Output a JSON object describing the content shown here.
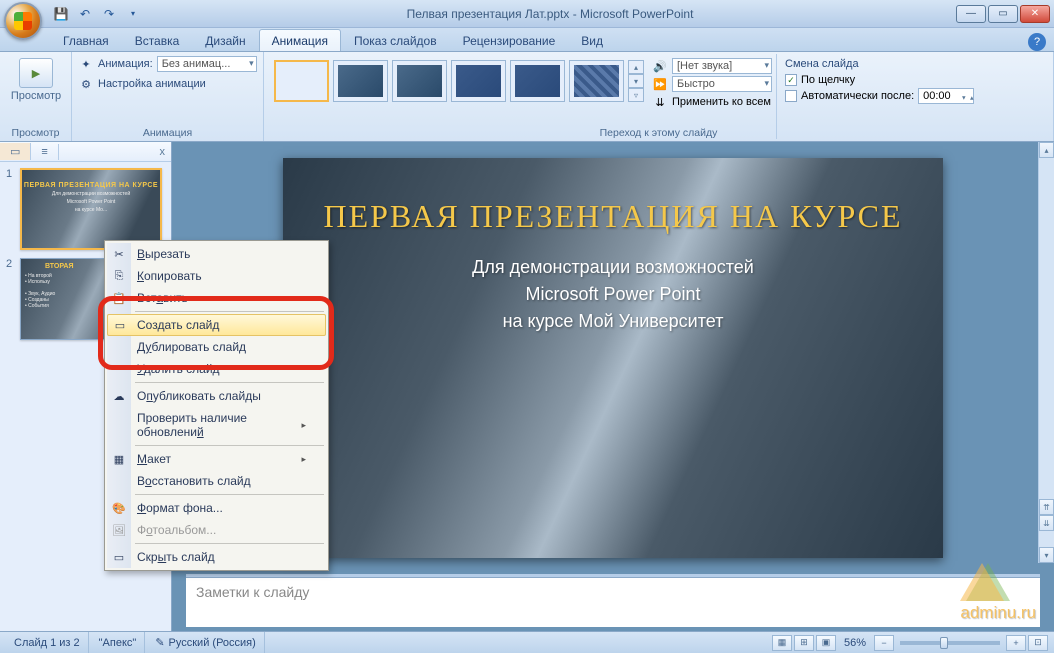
{
  "title": "Пелвая презентация Лат.pptx - Microsoft PowerPoint",
  "tabs": {
    "home": "Главная",
    "insert": "Вставка",
    "design": "Дизайн",
    "animation": "Анимация",
    "slideshow": "Показ слайдов",
    "review": "Рецензирование",
    "view": "Вид"
  },
  "ribbon": {
    "preview": {
      "label": "Просмотр",
      "group": "Просмотр"
    },
    "animation_group": {
      "label": "Анимация",
      "animate_label": "Анимация:",
      "animate_value": "Без анимац...",
      "custom_anim": "Настройка анимации"
    },
    "transition_group": {
      "label": "Переход к этому слайду",
      "sound_label": "[Нет звука]",
      "speed_label": "Быстро",
      "apply_all": "Применить ко всем"
    },
    "advance_group": {
      "title": "Смена слайда",
      "on_click": "По щелчку",
      "auto_after": "Автоматически после:",
      "time": "00:00"
    }
  },
  "leftpanel": {
    "tab_slides_icon": "▭",
    "tab_outline_icon": "≡",
    "close": "x"
  },
  "thumbs": [
    {
      "num": "1",
      "title": "ПЕРВАЯ ПРЕЗЕНТАЦИЯ НА КУРСЕ",
      "sub1": "Для демонстрации возможностей",
      "sub2": "Microsoft Power Point",
      "sub3": "на курсе Мо..."
    },
    {
      "num": "2",
      "title": "ВТОРАЯ",
      "sub": "..."
    }
  ],
  "slide": {
    "title": "ПЕРВАЯ ПРЕЗЕНТАЦИЯ НА КУРСЕ",
    "line1": "Для демонстрации возможностей",
    "line2": "Microsoft Power Point",
    "line3": "на курсе Мой Университет"
  },
  "notes": {
    "placeholder": "Заметки к слайду"
  },
  "context_menu": {
    "cut": "Вырезать",
    "copy": "Копировать",
    "paste": "Вставить",
    "new_slide": "Создать слайд",
    "duplicate": "Дублировать слайд",
    "delete": "Удалить слайд",
    "publish": "Опубликовать слайды",
    "check_updates": "Проверить наличие обновлений",
    "layout": "Макет",
    "reset": "Восстановить слайд",
    "format_bg": "Формат фона...",
    "photo_album": "Фотоальбом...",
    "hide": "Скрыть слайд"
  },
  "statusbar": {
    "slide_of": "Слайд 1 из 2",
    "theme": "\"Апекс\"",
    "language": "Русский (Россия)",
    "zoom": "56%"
  },
  "watermark": "adminu.ru"
}
